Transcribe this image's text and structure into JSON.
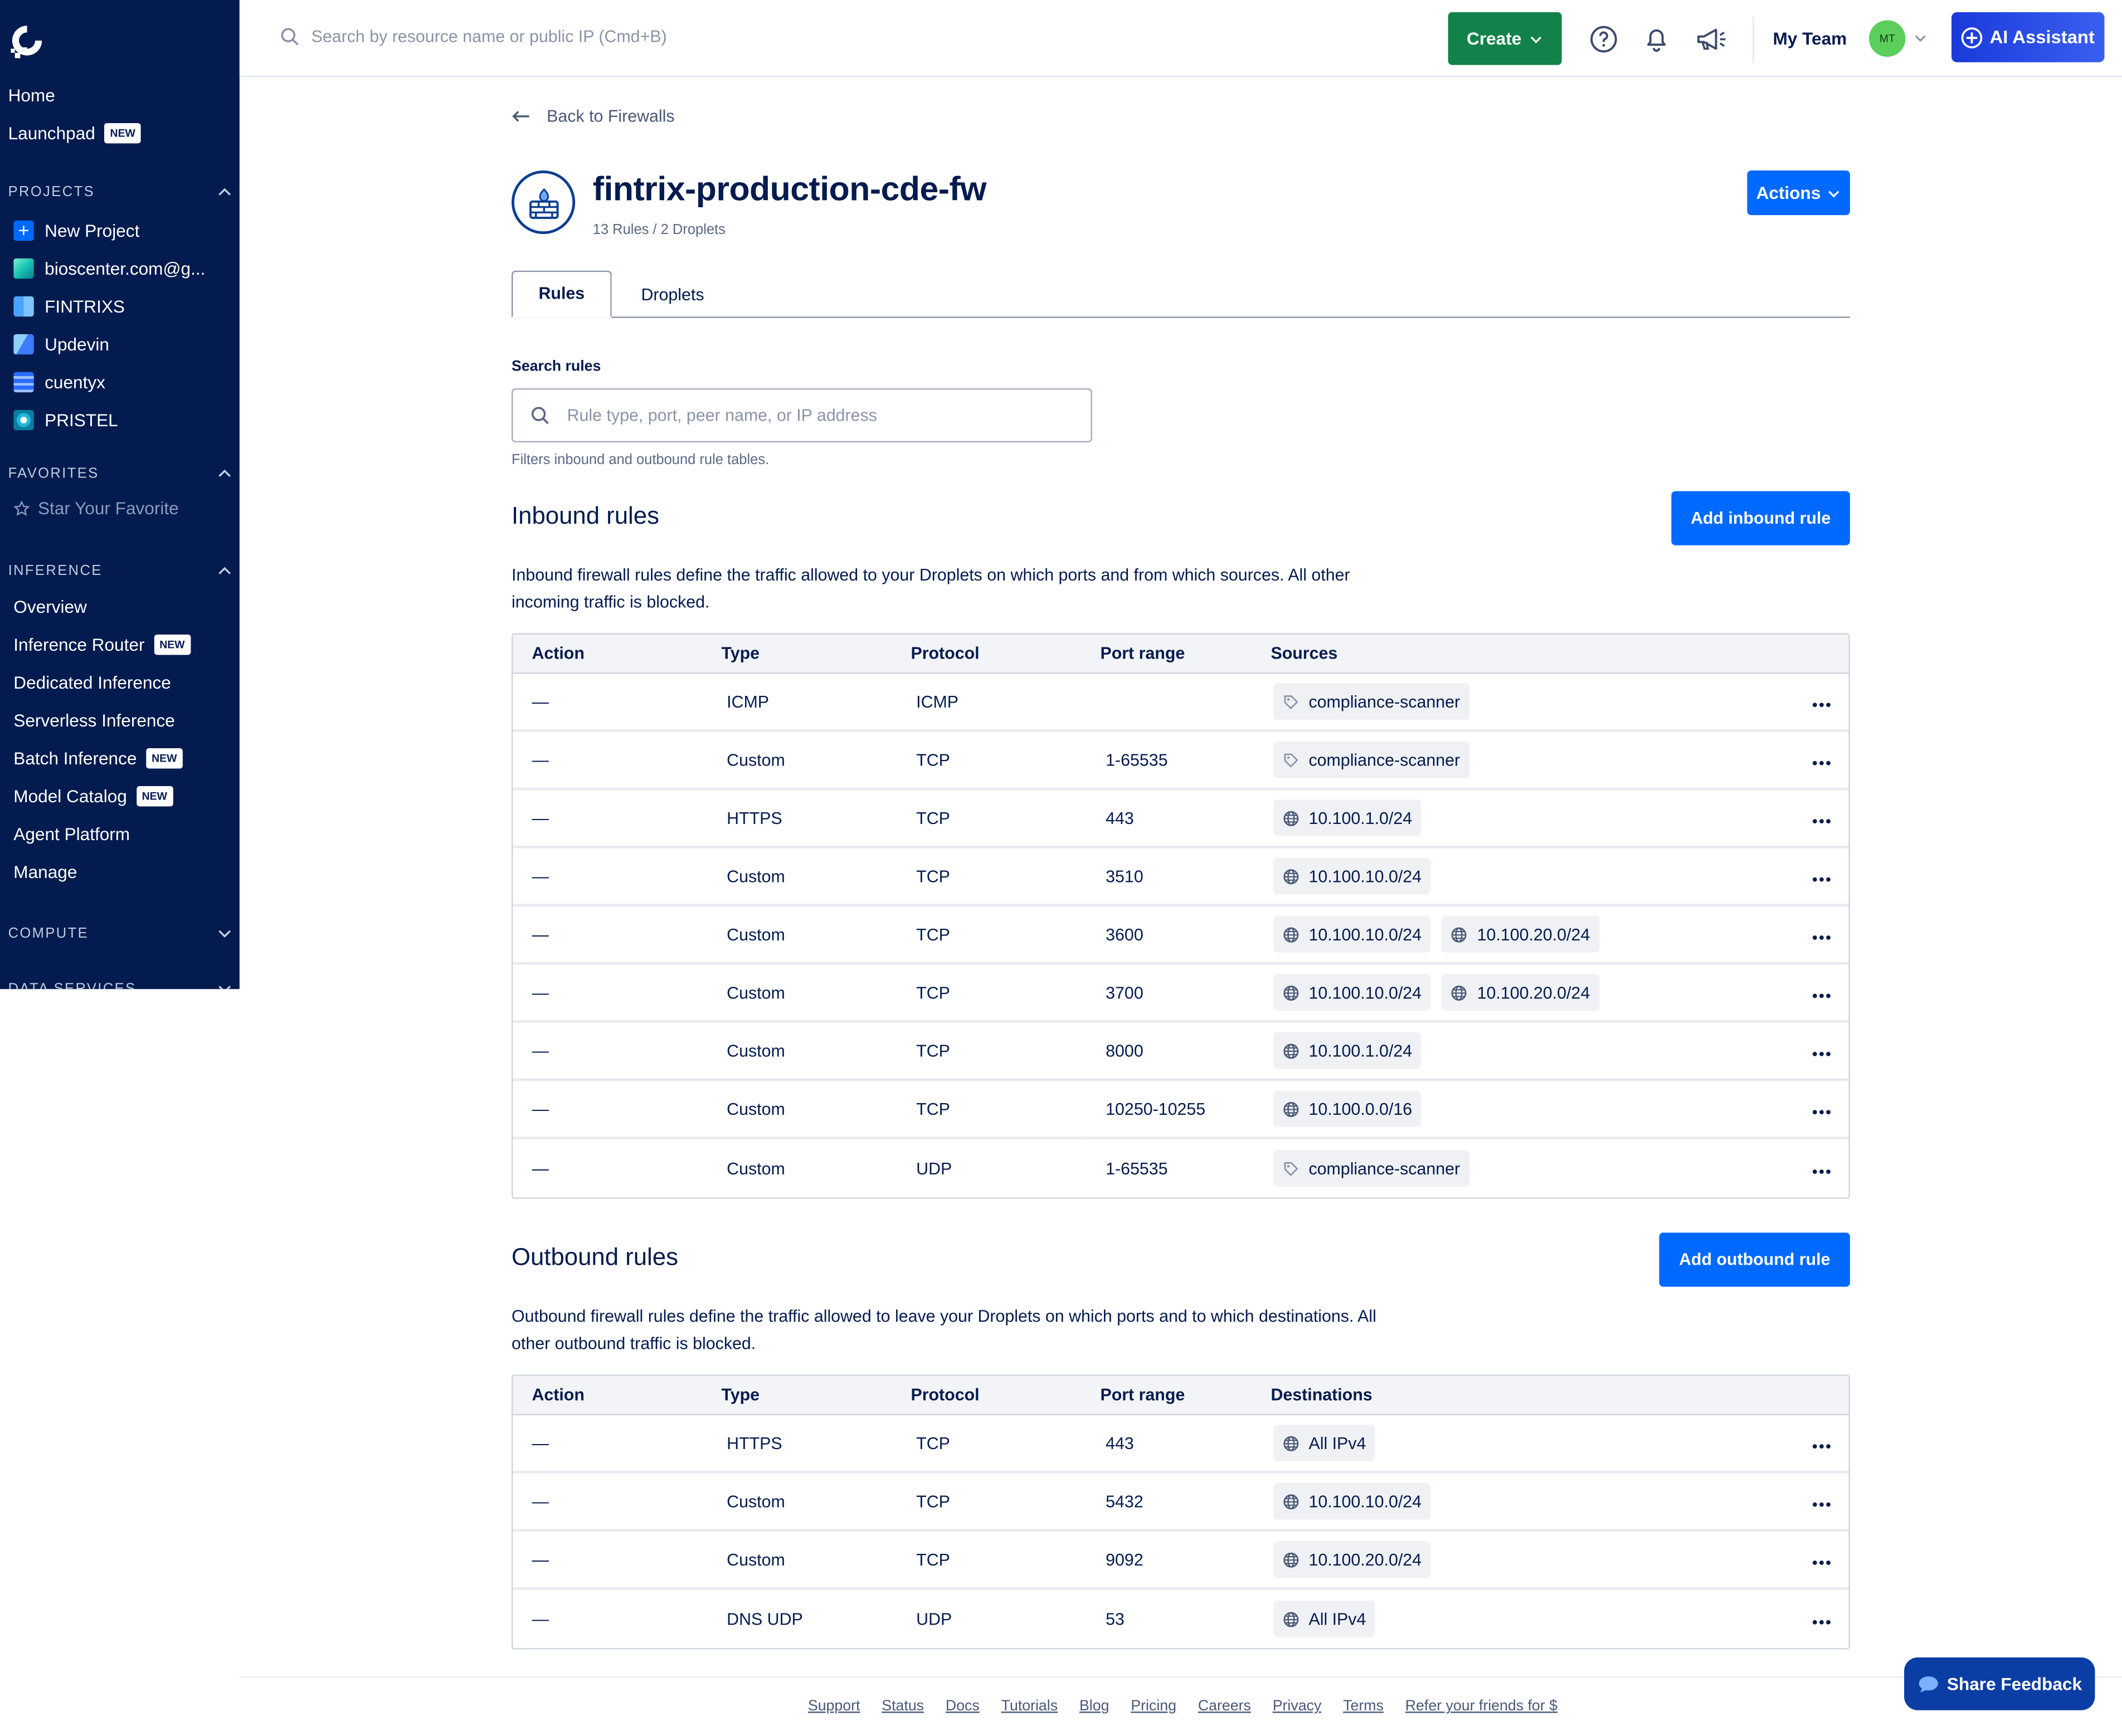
{
  "sidebar": {
    "nav": [
      {
        "label": "Home"
      },
      {
        "label": "Launchpad",
        "badge": "NEW"
      }
    ],
    "projects_header": "PROJECTS",
    "projects": [
      {
        "label": "New Project",
        "color": "#0069ff"
      },
      {
        "label": "bioscenter.com@g...",
        "color": "#17c3b2"
      },
      {
        "label": "FINTRIXS",
        "color": "#4aa3ff"
      },
      {
        "label": "Updevin",
        "color": "#3d7bff"
      },
      {
        "label": "cuentyx",
        "color": "#2a6bff"
      },
      {
        "label": "PRISTEL",
        "color": "#23b8d9"
      }
    ],
    "favorites_header": "FAVORITES",
    "favorites_empty": "Star Your Favorite",
    "inference_header": "INFERENCE",
    "inference_items": [
      {
        "label": "Overview",
        "badge": ""
      },
      {
        "label": "Inference Router",
        "badge": "NEW"
      },
      {
        "label": "Dedicated Inference",
        "badge": ""
      },
      {
        "label": "Serverless Inference",
        "badge": ""
      },
      {
        "label": "Batch Inference",
        "badge": "NEW"
      },
      {
        "label": "Model Catalog",
        "badge": "NEW"
      },
      {
        "label": "Agent Platform",
        "badge": ""
      },
      {
        "label": "Manage",
        "badge": ""
      }
    ],
    "compute_header": "COMPUTE",
    "data_services_header": "DATA SERVICES"
  },
  "topbar": {
    "search_placeholder": "Search by resource name or public IP (Cmd+B)",
    "create_label": "Create",
    "team_label": "My Team",
    "avatar_initials": "MT",
    "ai_label": "AI Assistant"
  },
  "page": {
    "back_label": "Back to Firewalls",
    "title": "fintrix-production-cde-fw",
    "subtitle": "13 Rules / 2 Droplets",
    "actions_label": "Actions",
    "tabs": [
      {
        "label": "Rules"
      },
      {
        "label": "Droplets"
      }
    ],
    "search_label": "Search rules",
    "search_placeholder": "Rule type, port, peer name, or IP address",
    "search_help": "Filters inbound and outbound rule tables."
  },
  "inbound": {
    "title": "Inbound rules",
    "add_label": "Add inbound rule",
    "description": "Inbound firewall rules define the traffic allowed to your Droplets on which ports and from which sources. All other incoming traffic is blocked.",
    "columns": {
      "action": "Action",
      "type": "Type",
      "protocol": "Protocol",
      "port": "Port range",
      "peers": "Sources"
    },
    "rows": [
      {
        "action": "—",
        "type": "ICMP",
        "protocol": "ICMP",
        "port": "",
        "peers": [
          {
            "kind": "tag",
            "label": "compliance-scanner"
          }
        ]
      },
      {
        "action": "—",
        "type": "Custom",
        "protocol": "TCP",
        "port": "1-65535",
        "peers": [
          {
            "kind": "tag",
            "label": "compliance-scanner"
          }
        ]
      },
      {
        "action": "—",
        "type": "HTTPS",
        "protocol": "TCP",
        "port": "443",
        "peers": [
          {
            "kind": "ip",
            "label": "10.100.1.0/24"
          }
        ]
      },
      {
        "action": "—",
        "type": "Custom",
        "protocol": "TCP",
        "port": "3510",
        "peers": [
          {
            "kind": "ip",
            "label": "10.100.10.0/24"
          }
        ]
      },
      {
        "action": "—",
        "type": "Custom",
        "protocol": "TCP",
        "port": "3600",
        "peers": [
          {
            "kind": "ip",
            "label": "10.100.10.0/24"
          },
          {
            "kind": "ip",
            "label": "10.100.20.0/24"
          }
        ]
      },
      {
        "action": "—",
        "type": "Custom",
        "protocol": "TCP",
        "port": "3700",
        "peers": [
          {
            "kind": "ip",
            "label": "10.100.10.0/24"
          },
          {
            "kind": "ip",
            "label": "10.100.20.0/24"
          }
        ]
      },
      {
        "action": "—",
        "type": "Custom",
        "protocol": "TCP",
        "port": "8000",
        "peers": [
          {
            "kind": "ip",
            "label": "10.100.1.0/24"
          }
        ]
      },
      {
        "action": "—",
        "type": "Custom",
        "protocol": "TCP",
        "port": "10250-10255",
        "peers": [
          {
            "kind": "ip",
            "label": "10.100.0.0/16"
          }
        ]
      },
      {
        "action": "—",
        "type": "Custom",
        "protocol": "UDP",
        "port": "1-65535",
        "peers": [
          {
            "kind": "tag",
            "label": "compliance-scanner"
          }
        ]
      }
    ]
  },
  "outbound": {
    "title": "Outbound rules",
    "add_label": "Add outbound rule",
    "description": "Outbound firewall rules define the traffic allowed to leave your Droplets on which ports and to which destinations. All other outbound traffic is blocked.",
    "columns": {
      "action": "Action",
      "type": "Type",
      "protocol": "Protocol",
      "port": "Port range",
      "peers": "Destinations"
    },
    "rows": [
      {
        "action": "—",
        "type": "HTTPS",
        "protocol": "TCP",
        "port": "443",
        "peers": [
          {
            "kind": "ip",
            "label": "All IPv4"
          }
        ]
      },
      {
        "action": "—",
        "type": "Custom",
        "protocol": "TCP",
        "port": "5432",
        "peers": [
          {
            "kind": "ip",
            "label": "10.100.10.0/24"
          }
        ]
      },
      {
        "action": "—",
        "type": "Custom",
        "protocol": "TCP",
        "port": "9092",
        "peers": [
          {
            "kind": "ip",
            "label": "10.100.20.0/24"
          }
        ]
      },
      {
        "action": "—",
        "type": "DNS UDP",
        "protocol": "UDP",
        "port": "53",
        "peers": [
          {
            "kind": "ip",
            "label": "All IPv4"
          }
        ]
      }
    ]
  },
  "footer": {
    "links": [
      "Support",
      "Status",
      "Docs",
      "Tutorials",
      "Blog",
      "Pricing",
      "Careers",
      "Privacy",
      "Terms",
      "Refer your friends for $"
    ]
  },
  "feedback_label": "Share Feedback",
  "colors": {
    "sidebar_bg": "#031b4e",
    "primary": "#0069ff",
    "create_green": "#12824a"
  }
}
